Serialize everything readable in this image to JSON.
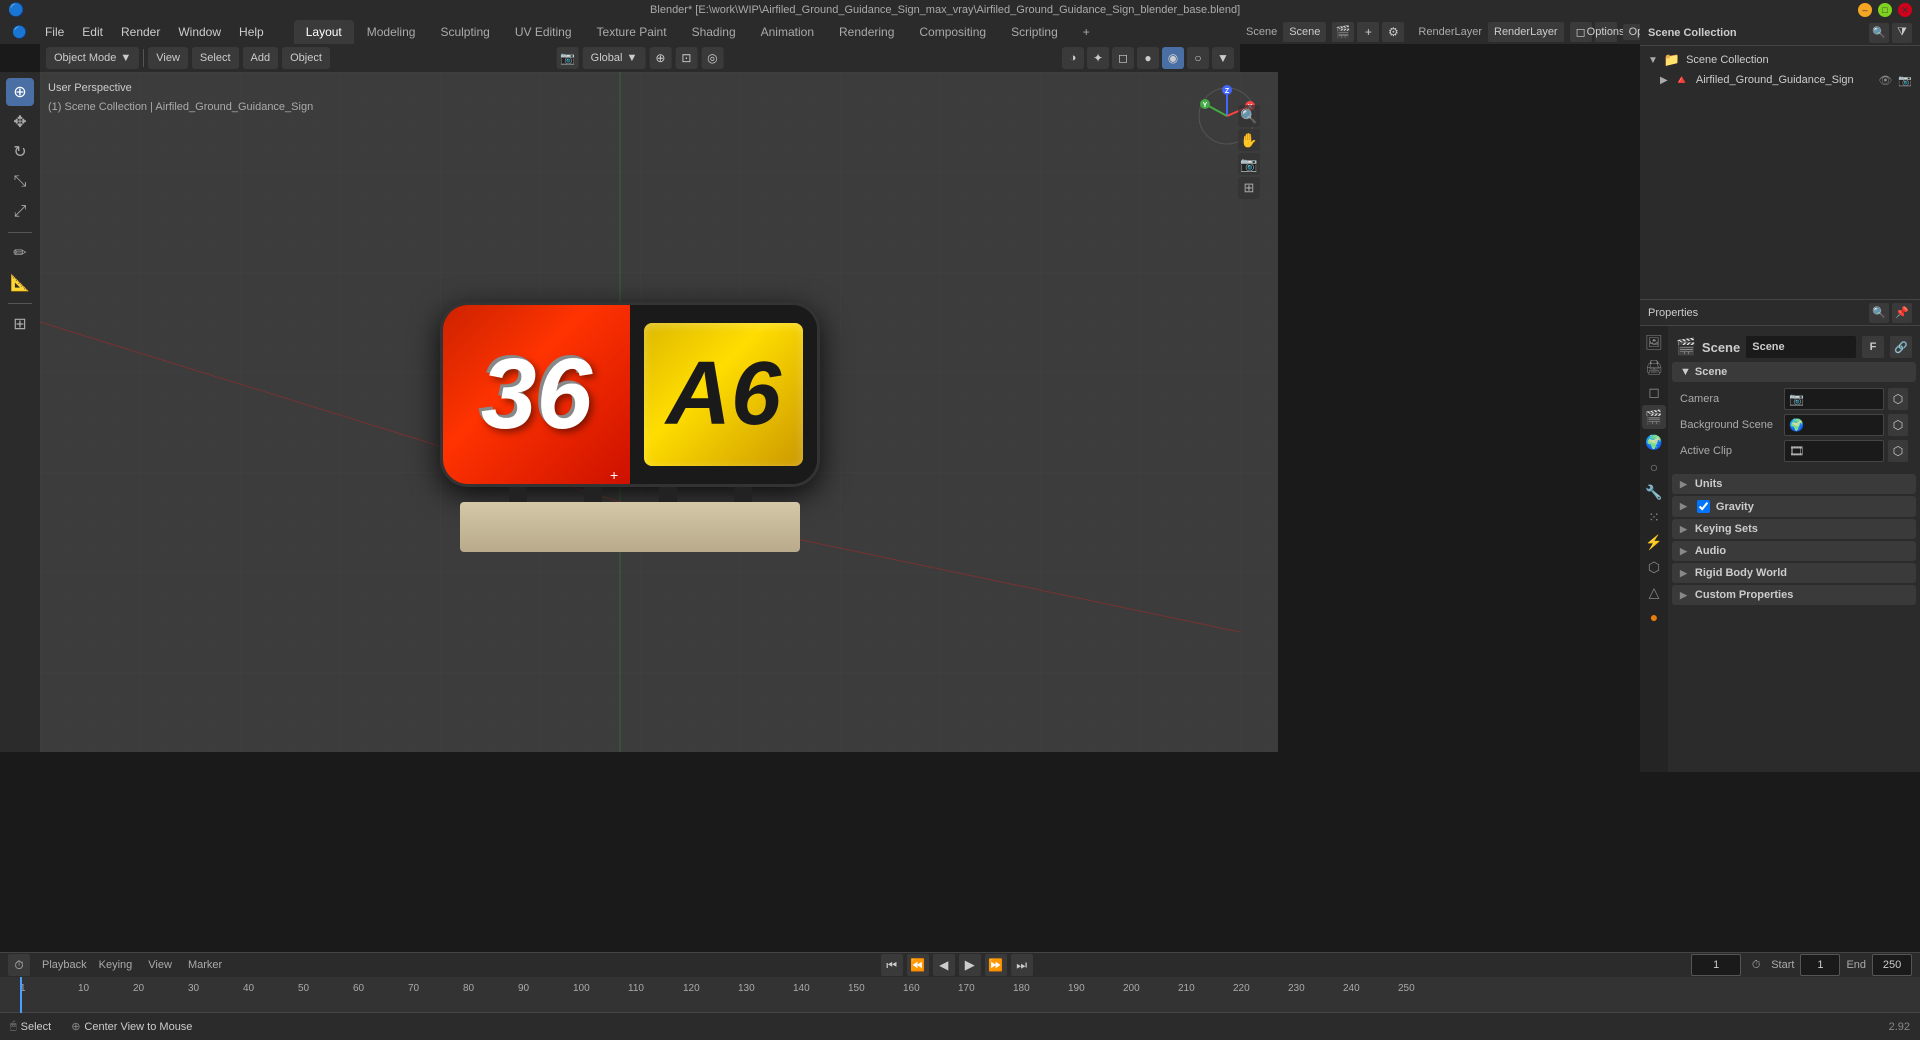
{
  "titlebar": {
    "title": "Blender* [E:\\work\\WIP\\Airfiled_Ground_Guidance_Sign_max_vray\\Airfiled_Ground_Guidance_Sign_blender_base.blend]",
    "minimize": "–",
    "maximize": "□",
    "close": "✕"
  },
  "menubar": {
    "items": [
      "Blender",
      "File",
      "Edit",
      "Render",
      "Window",
      "Help"
    ]
  },
  "workspace_tabs": {
    "tabs": [
      "Layout",
      "Modeling",
      "Sculpting",
      "UV Editing",
      "Texture Paint",
      "Shading",
      "Animation",
      "Rendering",
      "Compositing",
      "Scripting",
      "+"
    ]
  },
  "viewport": {
    "mode": "Object Mode",
    "view_label": "View",
    "select_label": "Select",
    "add_label": "Add",
    "object_label": "Object",
    "perspective": "User Perspective",
    "collection": "(1) Scene Collection | Airfiled_Ground_Guidance_Sign",
    "global_label": "Global",
    "sign_number": "36",
    "sign_code": "A6"
  },
  "outliner": {
    "header_label": "Scene Collection",
    "scene_name": "Airfiled_Ground_Guidance_Sign",
    "search_placeholder": "Search"
  },
  "properties": {
    "scene_label": "Scene",
    "render_layer_label": "RenderLayer",
    "scene_title": "Scene",
    "camera_label": "Camera",
    "background_scene_label": "Background Scene",
    "active_clip_label": "Active Clip",
    "sections": [
      {
        "name": "Units",
        "icon": "▶"
      },
      {
        "name": "Gravity",
        "icon": "▶",
        "checked": true
      },
      {
        "name": "Keying Sets",
        "icon": "▶"
      },
      {
        "name": "Audio",
        "icon": "▶"
      },
      {
        "name": "Rigid Body World",
        "icon": "▶"
      },
      {
        "name": "Custom Properties",
        "icon": "▶"
      }
    ]
  },
  "timeline": {
    "playback_label": "Playback",
    "keying_label": "Keying",
    "view_label": "View",
    "marker_label": "Marker",
    "start_label": "Start",
    "end_label": "End",
    "start_value": "1",
    "end_value": "250",
    "current_frame": "1",
    "frame_numbers": [
      "1",
      "10",
      "20",
      "30",
      "40",
      "50",
      "60",
      "70",
      "80",
      "90",
      "100",
      "110",
      "120",
      "130",
      "140",
      "150",
      "160",
      "170",
      "180",
      "190",
      "200",
      "210",
      "220",
      "230",
      "240",
      "250"
    ]
  },
  "statusbar": {
    "select_label": "Select",
    "center_view_label": "Center View to Mouse"
  },
  "toolbar": {
    "mode_label": "Object Mode",
    "options_label": "Options"
  },
  "icons": {
    "cursor": "⊕",
    "move": "✥",
    "rotate": "↺",
    "scale": "⤡",
    "transform": "⤢",
    "annotate": "✏",
    "measure": "📏",
    "add": "⊕",
    "scene": "🎬",
    "search": "🔍",
    "filter": "⧩",
    "collapse": "▶",
    "triangle_right": "▶",
    "triangle_down": "▼",
    "camera": "📷",
    "world": "🌍",
    "object": "○",
    "modifier": "🔧",
    "material": "●",
    "constraint": "⬡",
    "data": "△",
    "particle": "⁙",
    "physics": "⚡"
  }
}
